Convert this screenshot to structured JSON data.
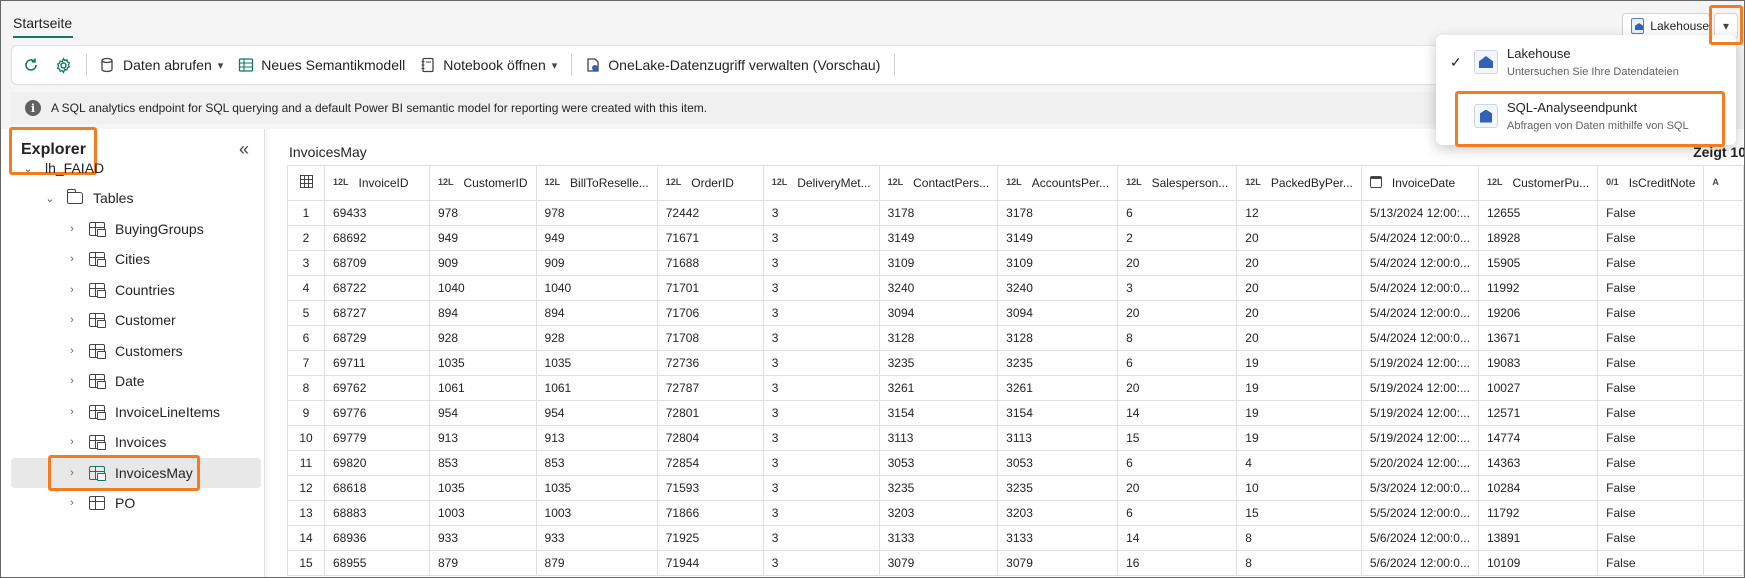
{
  "top_tab": "Startseite",
  "switcher": {
    "label": "Lakehouse",
    "chevron": "▾"
  },
  "toolbar": {
    "get_data": "Daten abrufen",
    "new_model": "Neues Semantikmodell",
    "open_notebook": "Notebook öffnen",
    "onelake": "OneLake-Datenzugriff verwalten (Vorschau)"
  },
  "banner": {
    "icon": "i",
    "text": "A SQL analytics endpoint for SQL querying and a default Power BI semantic model for reporting were created with this item."
  },
  "explorer": {
    "title": "Explorer",
    "collapse_glyph": "«",
    "root": "lh_FAIAD",
    "folder": "Tables",
    "tables": [
      "BuyingGroups",
      "Cities",
      "Countries",
      "Customer",
      "Customers",
      "Date",
      "InvoiceLineItems",
      "Invoices",
      "InvoicesMay",
      "PO"
    ],
    "selected": "InvoicesMay"
  },
  "grid": {
    "title": "InvoicesMay",
    "showing": "Zeigt 10",
    "columns": [
      {
        "type": "12L",
        "name": "InvoiceID"
      },
      {
        "type": "12L",
        "name": "CustomerID"
      },
      {
        "type": "12L",
        "name": "BillToReselle..."
      },
      {
        "type": "12L",
        "name": "OrderID"
      },
      {
        "type": "12L",
        "name": "DeliveryMet..."
      },
      {
        "type": "12L",
        "name": "ContactPers..."
      },
      {
        "type": "12L",
        "name": "AccountsPer..."
      },
      {
        "type": "12L",
        "name": "Salesperson..."
      },
      {
        "type": "12L",
        "name": "PackedByPer..."
      },
      {
        "type": "cal",
        "name": "InvoiceDate"
      },
      {
        "type": "12L",
        "name": "CustomerPu..."
      },
      {
        "type": "0/1",
        "name": "IsCreditNote"
      },
      {
        "type": "A",
        "name": ""
      }
    ],
    "rows": [
      [
        "1",
        "69433",
        "978",
        "978",
        "72442",
        "3",
        "3178",
        "3178",
        "6",
        "12",
        "5/13/2024 12:00:...",
        "12655",
        "False"
      ],
      [
        "2",
        "68692",
        "949",
        "949",
        "71671",
        "3",
        "3149",
        "3149",
        "2",
        "20",
        "5/4/2024 12:00:0...",
        "18928",
        "False"
      ],
      [
        "3",
        "68709",
        "909",
        "909",
        "71688",
        "3",
        "3109",
        "3109",
        "20",
        "20",
        "5/4/2024 12:00:0...",
        "15905",
        "False"
      ],
      [
        "4",
        "68722",
        "1040",
        "1040",
        "71701",
        "3",
        "3240",
        "3240",
        "3",
        "20",
        "5/4/2024 12:00:0...",
        "11992",
        "False"
      ],
      [
        "5",
        "68727",
        "894",
        "894",
        "71706",
        "3",
        "3094",
        "3094",
        "20",
        "20",
        "5/4/2024 12:00:0...",
        "19206",
        "False"
      ],
      [
        "6",
        "68729",
        "928",
        "928",
        "71708",
        "3",
        "3128",
        "3128",
        "8",
        "20",
        "5/4/2024 12:00:0...",
        "13671",
        "False"
      ],
      [
        "7",
        "69711",
        "1035",
        "1035",
        "72736",
        "3",
        "3235",
        "3235",
        "6",
        "19",
        "5/19/2024 12:00:...",
        "19083",
        "False"
      ],
      [
        "8",
        "69762",
        "1061",
        "1061",
        "72787",
        "3",
        "3261",
        "3261",
        "20",
        "19",
        "5/19/2024 12:00:...",
        "10027",
        "False"
      ],
      [
        "9",
        "69776",
        "954",
        "954",
        "72801",
        "3",
        "3154",
        "3154",
        "14",
        "19",
        "5/19/2024 12:00:...",
        "12571",
        "False"
      ],
      [
        "10",
        "69779",
        "913",
        "913",
        "72804",
        "3",
        "3113",
        "3113",
        "15",
        "19",
        "5/19/2024 12:00:...",
        "14774",
        "False"
      ],
      [
        "11",
        "69820",
        "853",
        "853",
        "72854",
        "3",
        "3053",
        "3053",
        "6",
        "4",
        "5/20/2024 12:00:...",
        "14363",
        "False"
      ],
      [
        "12",
        "68618",
        "1035",
        "1035",
        "71593",
        "3",
        "3235",
        "3235",
        "20",
        "10",
        "5/3/2024 12:00:0...",
        "10284",
        "False"
      ],
      [
        "13",
        "68883",
        "1003",
        "1003",
        "71866",
        "3",
        "3203",
        "3203",
        "6",
        "15",
        "5/5/2024 12:00:0...",
        "11792",
        "False"
      ],
      [
        "14",
        "68936",
        "933",
        "933",
        "71925",
        "3",
        "3133",
        "3133",
        "14",
        "8",
        "5/6/2024 12:00:0...",
        "13891",
        "False"
      ],
      [
        "15",
        "68955",
        "879",
        "879",
        "71944",
        "3",
        "3079",
        "3079",
        "16",
        "8",
        "5/6/2024 12:00:0...",
        "10109",
        "False"
      ]
    ]
  },
  "dropdown": {
    "items": [
      {
        "title": "Lakehouse",
        "subtitle": "Untersuchen Sie Ihre Datendateien",
        "checked": true,
        "icon": "lakehouse-icon"
      },
      {
        "title": "SQL-Analyseendpunkt",
        "subtitle": "Abfragen von Daten mithilfe von SQL",
        "checked": false,
        "icon": "sql-endpoint-icon"
      }
    ]
  },
  "colors": {
    "accent": "#117865",
    "highlight": "#f47b20",
    "selected_bg": "#e8e8e8"
  }
}
